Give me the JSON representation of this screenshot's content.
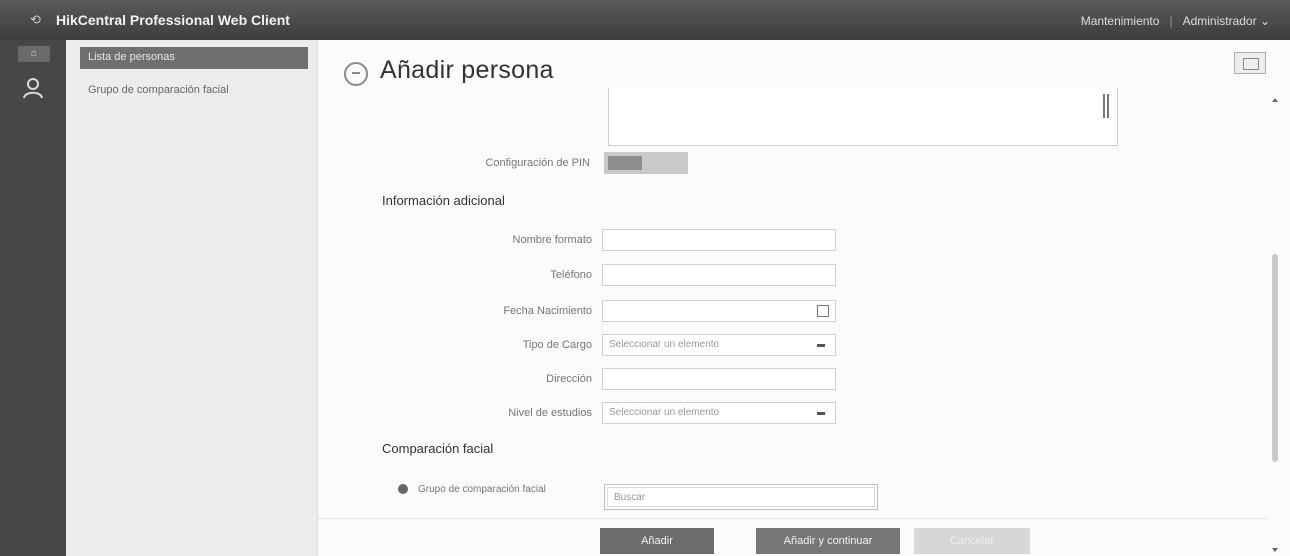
{
  "topbar": {
    "title": "HikCentral Professional Web Client",
    "maintenance": "Mantenimiento",
    "user": "Administrador"
  },
  "subnav": {
    "items": [
      {
        "label": "Lista de personas"
      },
      {
        "label": "Grupo de comparación facial"
      }
    ]
  },
  "page": {
    "title": "Añadir persona"
  },
  "form": {
    "pin_label": "Configuración de PIN",
    "additional_title": "Información adicional",
    "fields": {
      "nombre_formato": {
        "label": "Nombre formato",
        "value": ""
      },
      "telefono": {
        "label": "Teléfono",
        "value": ""
      },
      "fecha_nacimiento": {
        "label": "Fecha Nacimiento",
        "value": ""
      },
      "tipo_cargo": {
        "label": "Tipo de Cargo",
        "placeholder": "Seleccionar un elemento"
      },
      "direccion": {
        "label": "Dirección",
        "value": ""
      },
      "nivel_estudios": {
        "label": "Nivel de estudios",
        "placeholder": "Seleccionar un elemento"
      }
    },
    "face_title": "Comparación facial",
    "face_group_label": "Grupo de comparación facial",
    "search_placeholder": "Buscar"
  },
  "buttons": {
    "add": "Añadir",
    "add_continue": "Añadir y continuar",
    "cancel": "Cancelar"
  }
}
